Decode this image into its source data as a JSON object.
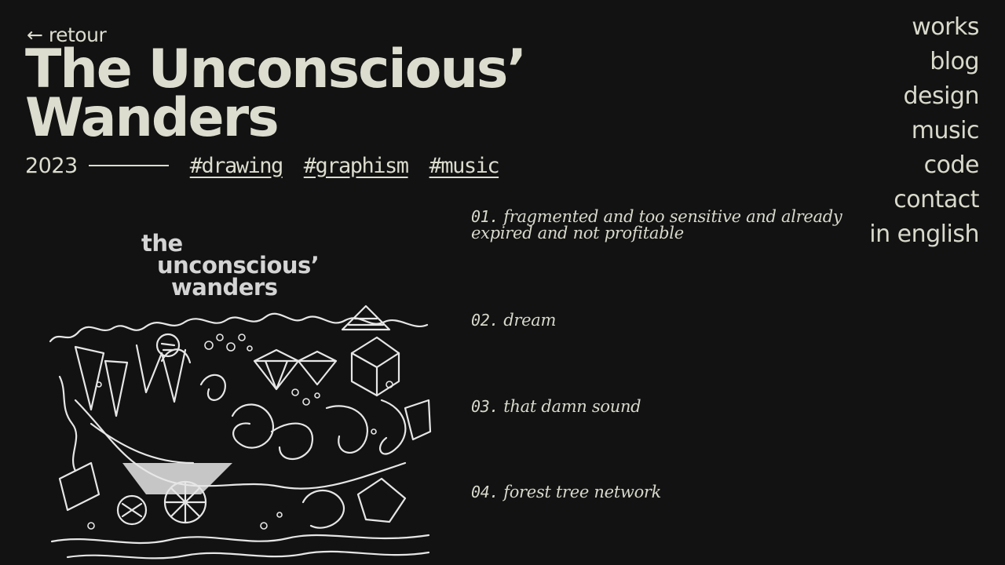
{
  "header": {
    "back_label": "← retour",
    "title_line1": "The Unconscious’",
    "title_line2": "Wanders",
    "year": "2023",
    "tags": [
      "#drawing",
      "#graphism",
      "#music"
    ]
  },
  "nav": {
    "items": [
      "works",
      "blog",
      "design",
      "music",
      "code",
      "contact",
      "in english"
    ]
  },
  "artwork": {
    "title_line1": "the",
    "title_line2": "unconscious’",
    "title_line3": "wanders"
  },
  "tracks": [
    {
      "number": "01.",
      "title": "fragmented and too sensitive and already expired and not profitable"
    },
    {
      "number": "02.",
      "title": "dream"
    },
    {
      "number": "03.",
      "title": "that damn sound"
    },
    {
      "number": "04.",
      "title": "forest tree network"
    }
  ],
  "colors": {
    "background": "#121212",
    "text": "#dcdccf"
  }
}
